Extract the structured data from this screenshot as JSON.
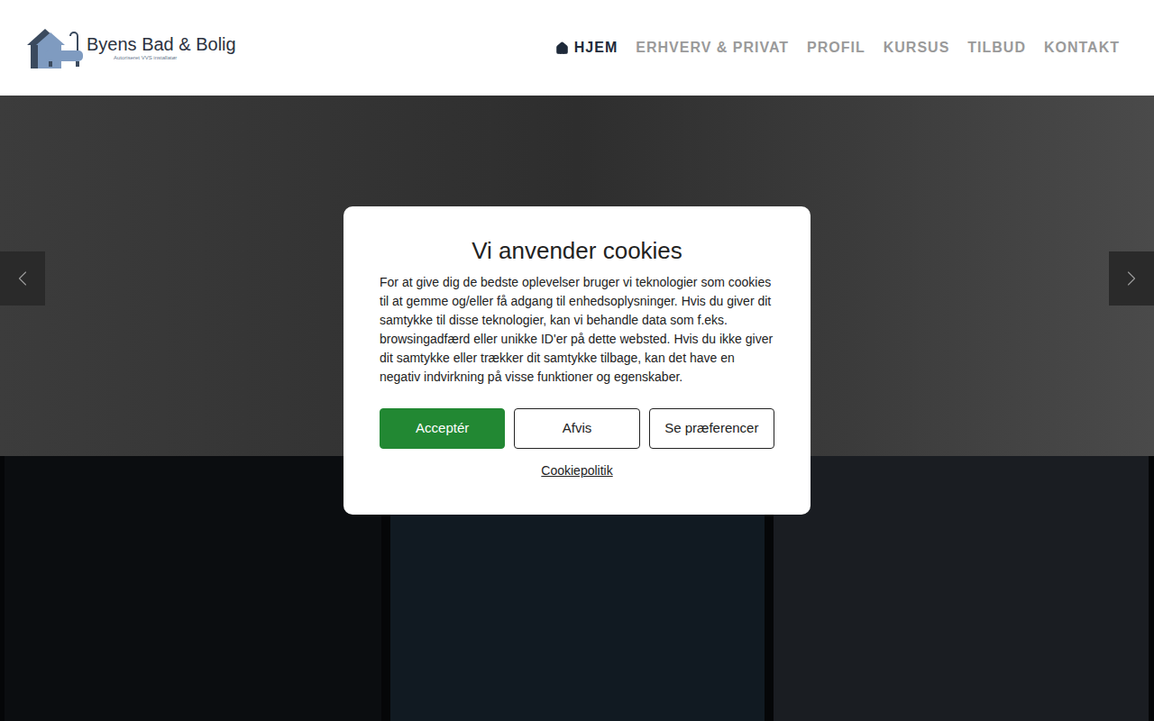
{
  "header": {
    "logo": {
      "name": "Byens Bad & Bolig",
      "subtitle": "Autoriseret VVS installatør"
    },
    "nav": [
      {
        "label": "HJEM",
        "selected": true
      },
      {
        "label": "ERHVERV & PRIVAT",
        "selected": false
      },
      {
        "label": "PROFIL",
        "selected": false
      },
      {
        "label": "KURSUS",
        "selected": false
      },
      {
        "label": "TILBUD",
        "selected": false
      },
      {
        "label": "KONTAKT",
        "selected": false
      }
    ]
  },
  "cookie_dialog": {
    "title": "Vi anvender cookies",
    "body": "For at give dig de bedste oplevelser bruger vi teknologier som cookies til at gemme og/eller få adgang til enhedsoplysninger. Hvis du giver dit samtykke til disse teknologier, kan vi behandle data som f.eks. browsingadfærd eller unikke ID'er på dette websted. Hvis du ikke giver dit samtykke eller trækker dit samtykke tilbage, kan det have en negativ indvirkning på visse funktioner og egenskaber.",
    "buttons": [
      {
        "label": "Acceptér",
        "kind": "primary"
      },
      {
        "label": "Afvis",
        "kind": "outline"
      },
      {
        "label": "Se præferencer",
        "kind": "outline"
      }
    ],
    "link": "Cookiepolitik"
  }
}
